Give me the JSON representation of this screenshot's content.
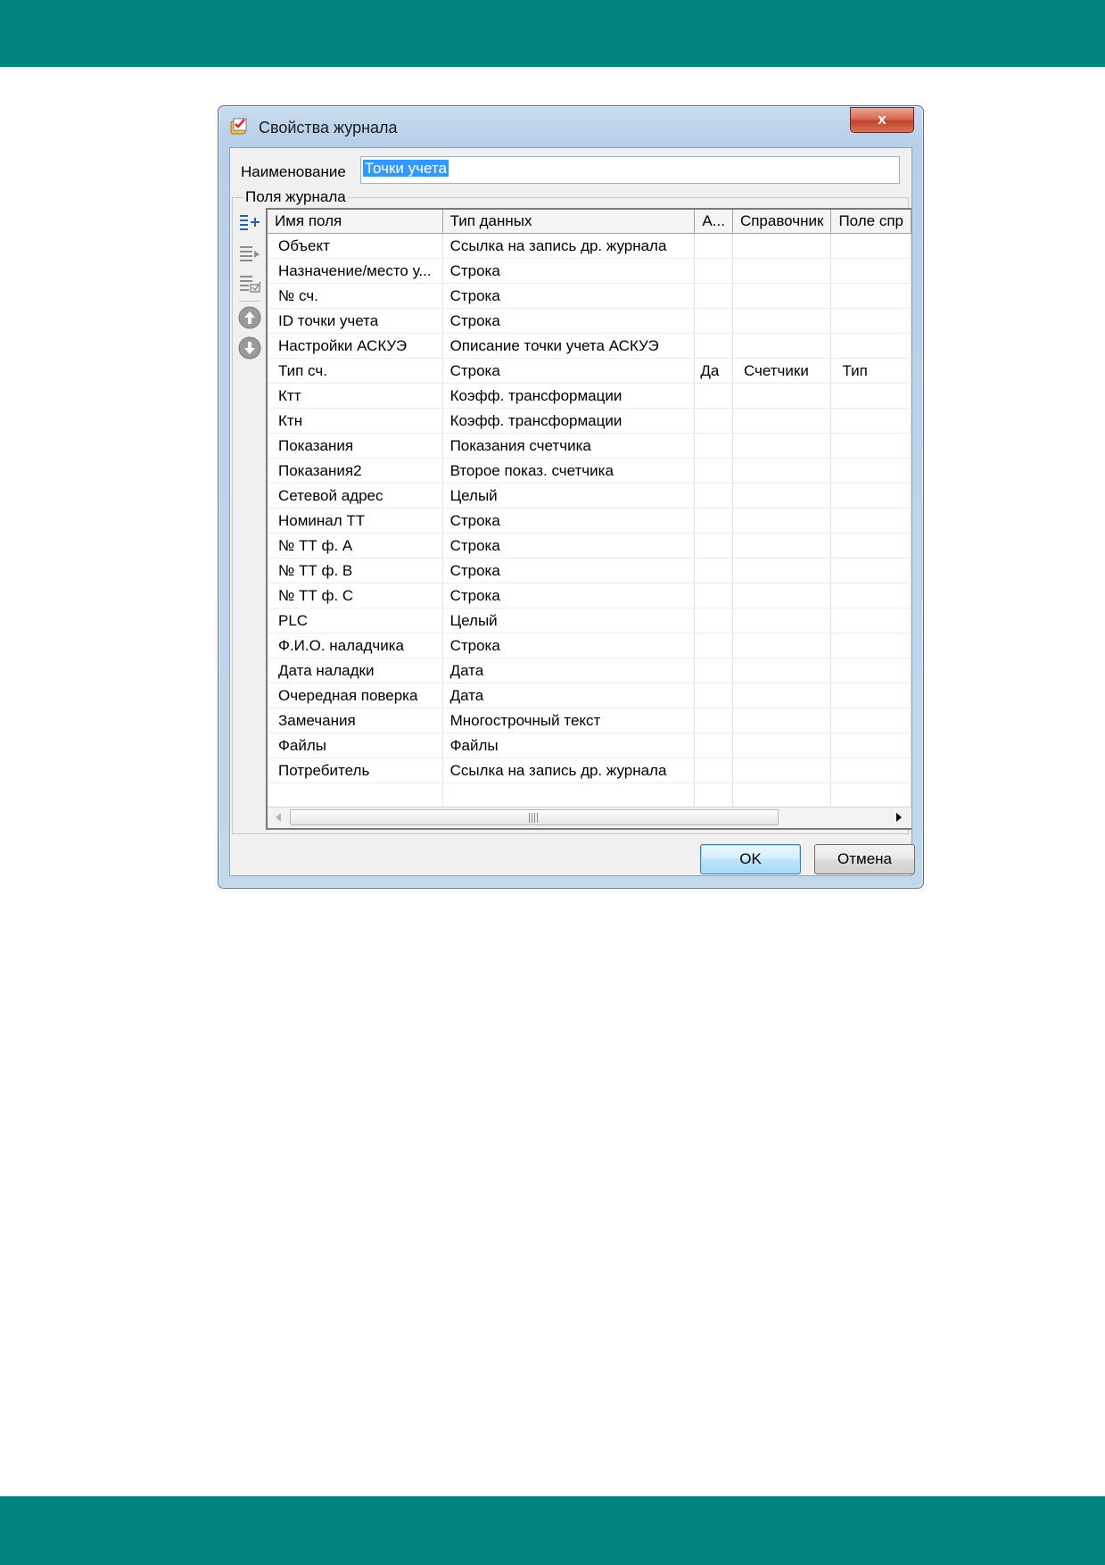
{
  "dialog": {
    "title": "Свойства журнала",
    "close_label": "x"
  },
  "name_field": {
    "label": "Наименование",
    "value": "Точки учета"
  },
  "group": {
    "label": "Поля журнала"
  },
  "toolbar": {
    "icons": [
      "add-field-icon",
      "insert-field-icon",
      "edit-field-icon",
      "move-up-icon",
      "move-down-icon"
    ]
  },
  "grid": {
    "columns": [
      "Имя поля",
      "Тип данных",
      "А...",
      "Справочник",
      "Поле спр"
    ],
    "rows": [
      [
        "Объект",
        "Ссылка на запись др. журнала",
        "",
        "",
        ""
      ],
      [
        "Назначение/место у...",
        "Строка",
        "",
        "",
        ""
      ],
      [
        "№ сч.",
        "Строка",
        "",
        "",
        ""
      ],
      [
        "ID точки учета",
        "Строка",
        "",
        "",
        ""
      ],
      [
        "Настройки АСКУЭ",
        "Описание точки учета АСКУЭ",
        "",
        "",
        ""
      ],
      [
        "Тип сч.",
        "Строка",
        "Да",
        "Счетчики",
        "Тип"
      ],
      [
        "Ктт",
        "Коэфф. трансформации",
        "",
        "",
        ""
      ],
      [
        "Ктн",
        "Коэфф. трансформации",
        "",
        "",
        ""
      ],
      [
        "Показания",
        "Показания счетчика",
        "",
        "",
        ""
      ],
      [
        "Показания2",
        "Второе показ. счетчика",
        "",
        "",
        ""
      ],
      [
        "Сетевой адрес",
        "Целый",
        "",
        "",
        ""
      ],
      [
        "Номинал ТТ",
        "Строка",
        "",
        "",
        ""
      ],
      [
        "№ ТТ ф. А",
        "Строка",
        "",
        "",
        ""
      ],
      [
        "№ ТТ ф. В",
        "Строка",
        "",
        "",
        ""
      ],
      [
        "№ ТТ ф. С",
        "Строка",
        "",
        "",
        ""
      ],
      [
        "PLC",
        "Целый",
        "",
        "",
        ""
      ],
      [
        "Ф.И.О. наладчика",
        "Строка",
        "",
        "",
        ""
      ],
      [
        "Дата наладки",
        "Дата",
        "",
        "",
        ""
      ],
      [
        "Очередная поверка",
        "Дата",
        "",
        "",
        ""
      ],
      [
        "Замечания",
        "Многострочный текст",
        "",
        "",
        ""
      ],
      [
        "Файлы",
        "Файлы",
        "",
        "",
        ""
      ],
      [
        "Потребитель",
        "Ссылка на запись др. журнала",
        "",
        "",
        ""
      ],
      [
        "",
        "",
        "",
        "",
        ""
      ]
    ]
  },
  "buttons": {
    "ok": "OK",
    "cancel": "Отмена"
  },
  "colors": {
    "page_band": "#00827f",
    "selection": "#3399ff"
  }
}
